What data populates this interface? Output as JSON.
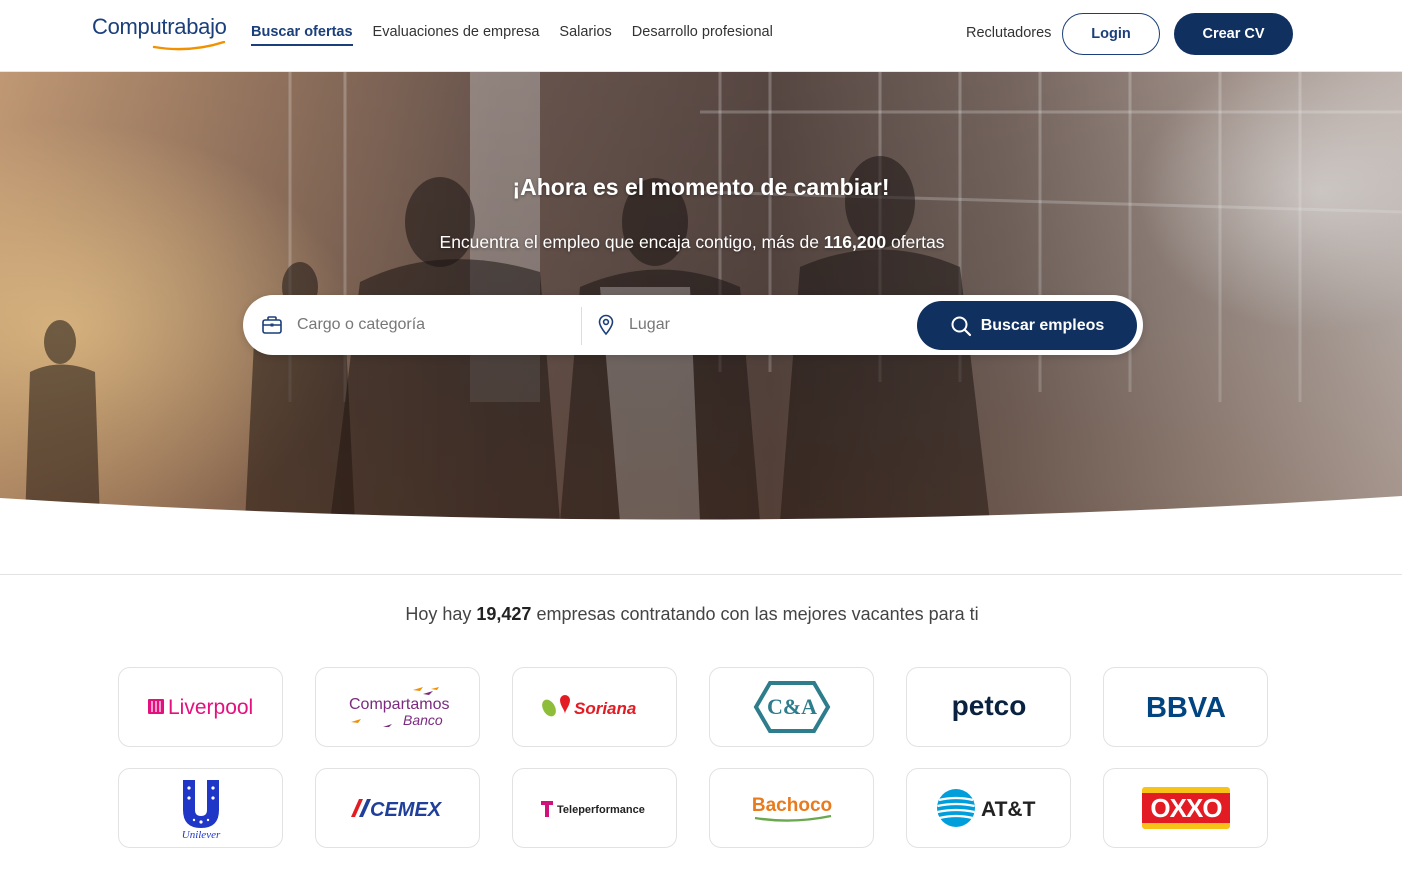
{
  "header": {
    "logo": "Computrabajo",
    "nav": [
      "Buscar ofertas",
      "Evaluaciones de empresa",
      "Salarios",
      "Desarrollo profesional"
    ],
    "recruiters": "Reclutadores",
    "login": "Login",
    "create_cv": "Crear CV"
  },
  "hero": {
    "title": "¡Ahora es el momento de cambiar!",
    "subtitle_pre": "Encuentra el empleo que encaja contigo, más de ",
    "subtitle_count": "116,200",
    "subtitle_post": " ofertas",
    "search": {
      "job_placeholder": "Cargo o categoría",
      "location_placeholder": "Lugar",
      "button": "Buscar empleos"
    }
  },
  "companies": {
    "text_pre": "Hoy hay ",
    "count": "19,427",
    "text_post": " empresas contratando con las mejores vacantes para ti",
    "logos": [
      "Liverpool",
      "Compartamos",
      "Banco",
      "Soriana",
      "C&A",
      "petco",
      "BBVA",
      "Unilever",
      "CEMEX",
      "Teleperformance",
      "Bachoco",
      "AT&T",
      "OXXO"
    ]
  },
  "colors": {
    "brand": "#1b3f7a",
    "button": "#10305f"
  }
}
